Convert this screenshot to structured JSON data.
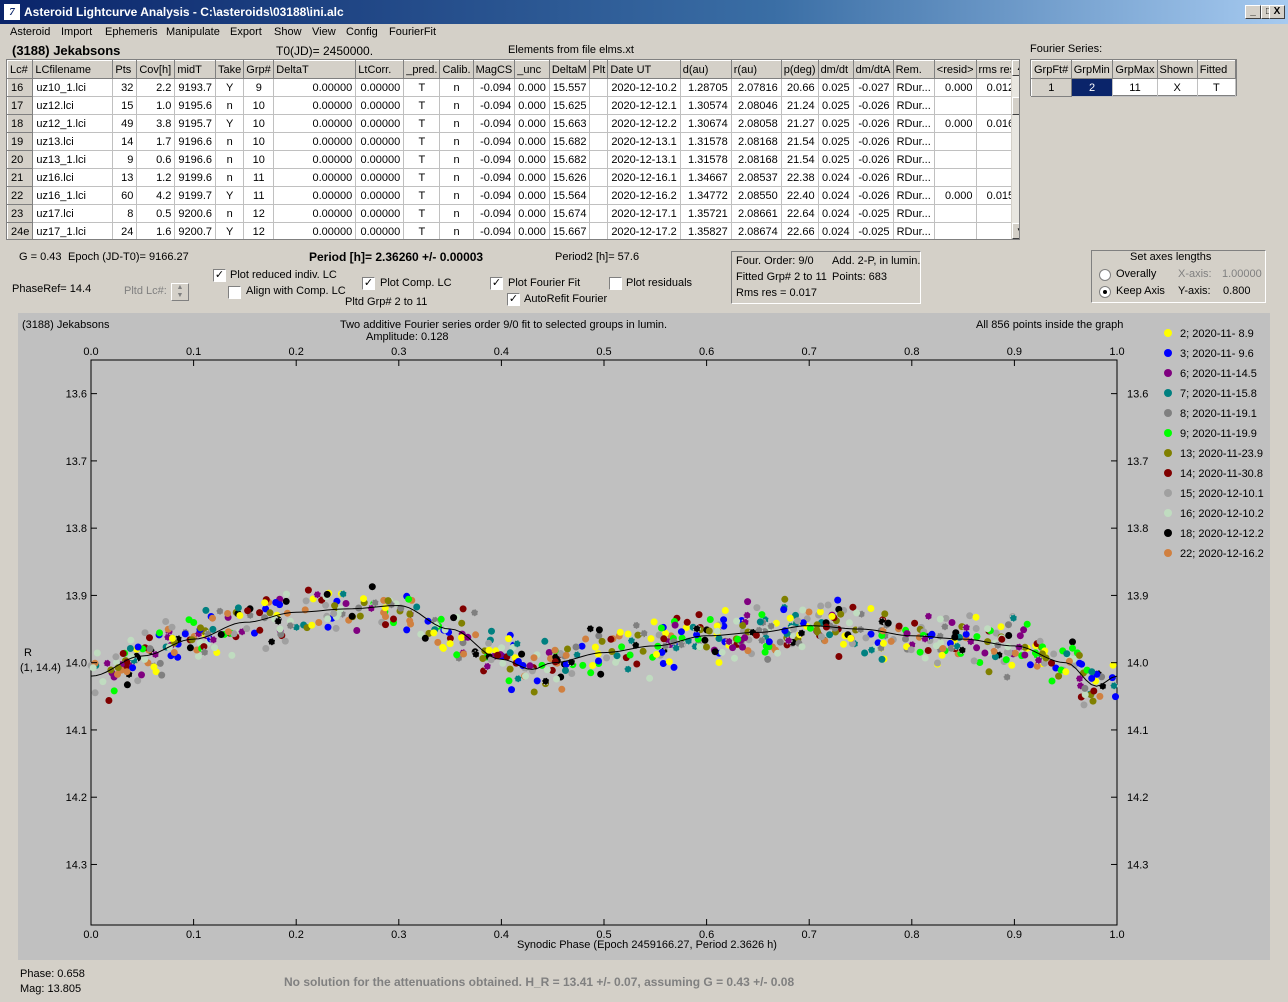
{
  "window": {
    "title": "Asteroid Lightcurve Analysis - C:\\asteroids\\03188\\ini.alc",
    "minimize": "_",
    "maximize": "□",
    "close": "X"
  },
  "menu": [
    "Asteroid",
    "Import",
    "Ephemeris",
    "Manipulate",
    "Export",
    "Show",
    "View",
    "Config",
    "FourierFit"
  ],
  "header": {
    "asteroid_name": "(3188) Jekabsons",
    "t0": "T0(JD)= 2450000.",
    "elements": "Elements from file elms.xt",
    "fourier_series_label": "Fourier Series:"
  },
  "lc_table": {
    "columns": [
      "Lc#",
      "LCfilename",
      "Pts",
      "Cov[h]",
      "midT",
      "Take",
      "Grp#",
      "DeltaT",
      "LtCorr.",
      "_pred.",
      "Calib.",
      "MagCS",
      "_unc",
      "DeltaM",
      "Plt",
      "Date UT",
      "d(au)",
      "r(au)",
      "p(deg)",
      "dm/dt",
      "dm/dtA",
      "Rem.",
      "<resid>",
      "rms res"
    ],
    "rows": [
      [
        "16",
        "uz10_1.lci",
        "32",
        "2.2",
        "9193.7",
        "Y",
        "9",
        "0.00000",
        "0.00000",
        "T",
        "n",
        "-0.094",
        "0.000",
        "15.557",
        "",
        "2020-12-10.2",
        "1.28705",
        "2.07816",
        "20.66",
        "0.025",
        "-0.027",
        "RDur...",
        "0.000",
        "0.012"
      ],
      [
        "17",
        "uz12.lci",
        "15",
        "1.0",
        "9195.6",
        "n",
        "10",
        "0.00000",
        "0.00000",
        "T",
        "n",
        "-0.094",
        "0.000",
        "15.625",
        "",
        "2020-12-12.1",
        "1.30574",
        "2.08046",
        "21.24",
        "0.025",
        "-0.026",
        "RDur...",
        "",
        ""
      ],
      [
        "18",
        "uz12_1.lci",
        "49",
        "3.8",
        "9195.7",
        "Y",
        "10",
        "0.00000",
        "0.00000",
        "T",
        "n",
        "-0.094",
        "0.000",
        "15.663",
        "",
        "2020-12-12.2",
        "1.30674",
        "2.08058",
        "21.27",
        "0.025",
        "-0.026",
        "RDur...",
        "0.000",
        "0.016"
      ],
      [
        "19",
        "uz13.lci",
        "14",
        "1.7",
        "9196.6",
        "n",
        "10",
        "0.00000",
        "0.00000",
        "T",
        "n",
        "-0.094",
        "0.000",
        "15.682",
        "",
        "2020-12-13.1",
        "1.31578",
        "2.08168",
        "21.54",
        "0.025",
        "-0.026",
        "RDur...",
        "",
        ""
      ],
      [
        "20",
        "uz13_1.lci",
        "9",
        "0.6",
        "9196.6",
        "n",
        "10",
        "0.00000",
        "0.00000",
        "T",
        "n",
        "-0.094",
        "0.000",
        "15.682",
        "",
        "2020-12-13.1",
        "1.31578",
        "2.08168",
        "21.54",
        "0.025",
        "-0.026",
        "RDur...",
        "",
        ""
      ],
      [
        "21",
        "uz16.lci",
        "13",
        "1.2",
        "9199.6",
        "n",
        "11",
        "0.00000",
        "0.00000",
        "T",
        "n",
        "-0.094",
        "0.000",
        "15.626",
        "",
        "2020-12-16.1",
        "1.34667",
        "2.08537",
        "22.38",
        "0.024",
        "-0.026",
        "RDur...",
        "",
        ""
      ],
      [
        "22",
        "uz16_1.lci",
        "60",
        "4.2",
        "9199.7",
        "Y",
        "11",
        "0.00000",
        "0.00000",
        "T",
        "n",
        "-0.094",
        "0.000",
        "15.564",
        "",
        "2020-12-16.2",
        "1.34772",
        "2.08550",
        "22.40",
        "0.024",
        "-0.026",
        "RDur...",
        "0.000",
        "0.015"
      ],
      [
        "23",
        "uz17.lci",
        "8",
        "0.5",
        "9200.6",
        "n",
        "12",
        "0.00000",
        "0.00000",
        "T",
        "n",
        "-0.094",
        "0.000",
        "15.674",
        "",
        "2020-12-17.1",
        "1.35721",
        "2.08661",
        "22.64",
        "0.024",
        "-0.025",
        "RDur...",
        "",
        ""
      ],
      [
        "24e",
        "uz17_1.lci",
        "24",
        "1.6",
        "9200.7",
        "Y",
        "12",
        "0.00000",
        "0.00000",
        "T",
        "n",
        "-0.094",
        "0.000",
        "15.667",
        "",
        "2020-12-17.2",
        "1.35827",
        "2.08674",
        "22.66",
        "0.024",
        "-0.025",
        "RDur...",
        "",
        ""
      ]
    ]
  },
  "fourier_table": {
    "columns": [
      "GrpFt#",
      "GrpMin",
      "GrpMax",
      "Shown",
      "Fitted"
    ],
    "row": [
      "1",
      "2",
      "11",
      "X",
      "T"
    ]
  },
  "params": {
    "g": "G = 0.43",
    "epoch": "Epoch (JD-T0)= 9166.27",
    "period": "Period [h]= 2.36260 +/- 0.00003",
    "period2": "Period2 [h]= 57.6",
    "phase_ref": "PhaseRef= 14.4",
    "pltd_lc": "Pltd Lc#:",
    "pltd_grp": "Pltd Grp#  2  to   11"
  },
  "checkboxes": {
    "plot_reduced": {
      "label": "Plot reduced indiv. LC",
      "checked": true
    },
    "align_comp": {
      "label": "Align with Comp. LC",
      "checked": false
    },
    "plot_comp": {
      "label": "Plot Comp. LC",
      "checked": true
    },
    "plot_fourier": {
      "label": "Plot Fourier Fit",
      "checked": true
    },
    "autorefit": {
      "label": "AutoRefit Fourier",
      "checked": true
    },
    "plot_residuals": {
      "label": "Plot residuals",
      "checked": false
    }
  },
  "fit_info": {
    "order": "Four. Order:  9/0",
    "mode": "Add. 2-P, in lumin.",
    "fitted_grp": "Fitted Grp# 2 to 11",
    "points": "Points: 683",
    "rms": "Rms res      = 0.017"
  },
  "axes_box": {
    "title": "Set axes lengths",
    "overally": "Overally",
    "keep_axis": "Keep Axis",
    "x_axis_label": "X-axis:",
    "x_axis_value": "1.00000",
    "y_axis_label": "Y-axis:",
    "y_axis_value": "0.800",
    "selected": "Keep Axis"
  },
  "plot": {
    "name": "(3188) Jekabsons",
    "title_line1": "Two additive Fourier series order 9/0 fit to selected groups in lumin.",
    "title_line2": "Amplitude: 0.128",
    "points_note": "All 856 points inside the graph",
    "ylabel": "R",
    "ylabel2": "(1, 14.4)",
    "xlabel": "Synodic Phase (Epoch 2459166.27, Period 2.3626 h)",
    "background": "#c0c0c0"
  },
  "chart_data": {
    "type": "scatter",
    "xlim": [
      0.0,
      1.0
    ],
    "ylim": [
      13.55,
      14.39
    ],
    "y_inverted": true,
    "x_ticks": [
      "0.0",
      "0.1",
      "0.2",
      "0.3",
      "0.4",
      "0.5",
      "0.6",
      "0.7",
      "0.8",
      "0.9",
      "1.0"
    ],
    "y_ticks": [
      "13.6",
      "13.7",
      "13.8",
      "13.9",
      "14.0",
      "14.1",
      "14.2",
      "14.3"
    ],
    "legend_position": "right",
    "series": [
      {
        "name": "2; 2020-11- 8.9",
        "color": "#ffff00",
        "marker": "dot"
      },
      {
        "name": "3; 2020-11- 9.6",
        "color": "#0000ff",
        "marker": "dot"
      },
      {
        "name": "6; 2020-11-14.5",
        "color": "#800080",
        "marker": "dot"
      },
      {
        "name": "7; 2020-11-15.8",
        "color": "#008080",
        "marker": "dot"
      },
      {
        "name": "8; 2020-11-19.1",
        "color": "#808080",
        "marker": "dot"
      },
      {
        "name": "9; 2020-11-19.9",
        "color": "#00ff00",
        "marker": "dot"
      },
      {
        "name": "13; 2020-11-23.9",
        "color": "#808000",
        "marker": "dot"
      },
      {
        "name": "14; 2020-11-30.8",
        "color": "#800000",
        "marker": "dot"
      },
      {
        "name": "15; 2020-12-10.1",
        "color": "#a0a0a0",
        "marker": "dot"
      },
      {
        "name": "16; 2020-12-10.2",
        "color": "#c0dcc0",
        "marker": "dot"
      },
      {
        "name": "18; 2020-12-12.2",
        "color": "#000000",
        "marker": "dot"
      },
      {
        "name": "22; 2020-12-16.2",
        "color": "#d08040",
        "marker": "dot"
      }
    ],
    "fit_curve": {
      "x": [
        0.0,
        0.05,
        0.1,
        0.15,
        0.2,
        0.25,
        0.3,
        0.35,
        0.4,
        0.43,
        0.45,
        0.5,
        0.55,
        0.6,
        0.65,
        0.7,
        0.75,
        0.8,
        0.85,
        0.9,
        0.95,
        0.98,
        1.0
      ],
      "y": [
        14.02,
        13.99,
        13.965,
        13.94,
        13.925,
        13.92,
        13.915,
        13.95,
        13.995,
        14.01,
        14.0,
        13.985,
        13.975,
        13.96,
        13.955,
        13.945,
        13.95,
        13.96,
        13.965,
        13.975,
        14.0,
        14.035,
        14.02
      ]
    }
  },
  "status": {
    "phase": "Phase:  0.658",
    "mag": "Mag:    13.805",
    "message": "No solution for the attenuations obtained.  H_R = 13.41 +/- 0.07, assuming G = 0.43 +/- 0.08"
  }
}
